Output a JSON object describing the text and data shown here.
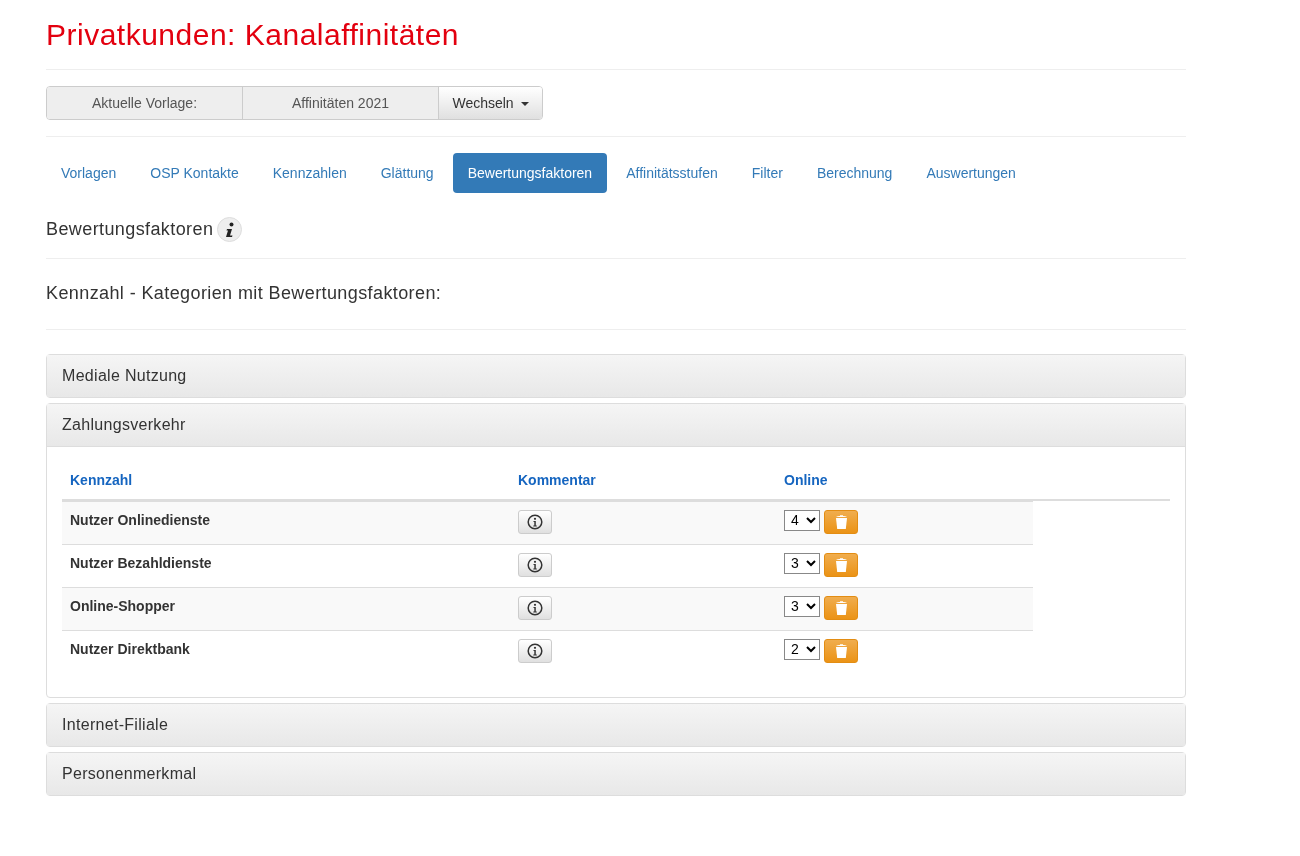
{
  "title": "Privatkunden: Kanalaffinitäten",
  "template": {
    "label": "Aktuelle Vorlage:",
    "value": "Affinitäten 2021",
    "button": "Wechseln"
  },
  "tabs": [
    {
      "label": "Vorlagen",
      "selected": false
    },
    {
      "label": "OSP Kontakte",
      "selected": false
    },
    {
      "label": "Kennzahlen",
      "selected": false
    },
    {
      "label": "Glättung",
      "selected": false
    },
    {
      "label": "Bewertungsfaktoren",
      "selected": true
    },
    {
      "label": "Affinitätsstufen",
      "selected": false
    },
    {
      "label": "Filter",
      "selected": false
    },
    {
      "label": "Berechnung",
      "selected": false
    },
    {
      "label": "Auswertungen",
      "selected": false
    }
  ],
  "section_heading": "Bewertungsfaktoren",
  "subheading": "Kennzahl - Kategorien mit Bewertungsfaktoren:",
  "panels": [
    {
      "title": "Mediale Nutzung",
      "expanded": false
    },
    {
      "title": "Zahlungsverkehr",
      "expanded": true,
      "table": {
        "columns": [
          "Kennzahl",
          "Kommentar",
          "Online"
        ],
        "rows": [
          {
            "name": "Nutzer Onlinedienste",
            "online": "4"
          },
          {
            "name": "Nutzer Bezahldienste",
            "online": "3"
          },
          {
            "name": "Online-Shopper",
            "online": "3"
          },
          {
            "name": "Nutzer Direktbank",
            "online": "2"
          }
        ]
      }
    },
    {
      "title": "Internet-Filiale",
      "expanded": false
    },
    {
      "title": "Personenmerkmal",
      "expanded": false
    }
  ]
}
